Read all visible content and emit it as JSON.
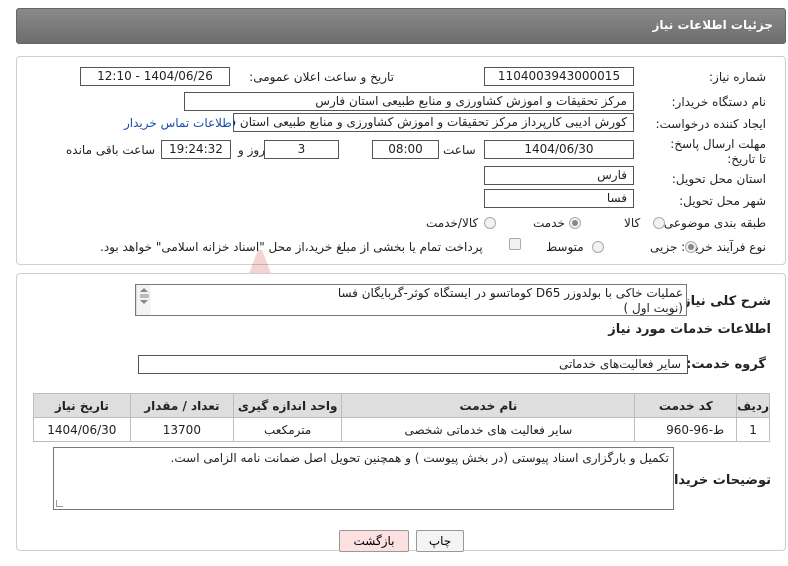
{
  "header": {
    "title": "جزئیات اطلاعات نیاز"
  },
  "fields": {
    "need_number_label": "شماره نیاز:",
    "need_number": "1104003943000015",
    "announce_label": "تاریخ و ساعت اعلان عمومی:",
    "announce_value": "1404/06/26 - 12:10",
    "buyer_label": "نام دستگاه خریدار:",
    "buyer_value": "مرکز تحقیقات و اموزش کشاورزی و منابع طبیعی استان فارس",
    "creator_label": "ایجاد کننده درخواست:",
    "creator_value": "کورش ادیبی کارپرداز مرکز تحقیقات و اموزش کشاورزی و منابع طبیعی استان فارس",
    "contact_link": "اطلاعات تماس خریدار",
    "deadline_label": "مهلت ارسال پاسخ: تا تاریخ:",
    "deadline_date": "1404/06/30",
    "time_label": "ساعت",
    "deadline_time": "08:00",
    "days_value": "3",
    "days_label": "روز و",
    "remaining_time": "19:24:32",
    "remaining_label": "ساعت باقی مانده",
    "province_label": "استان محل تحویل:",
    "province_value": "فارس",
    "city_label": "شهر محل تحویل:",
    "city_value": "فسا",
    "category_label": "طبقه بندی موضوعی:",
    "category_options": [
      "کالا",
      "خدمت",
      "کالا/خدمت"
    ],
    "process_label": "نوع فرآیند خرید :",
    "process_options": [
      "جزیی",
      "متوسط"
    ],
    "payment_note": "پرداخت تمام یا بخشی از مبلغ خرید،از محل \"اسناد خزانه اسلامی\" خواهد بود."
  },
  "summary": {
    "label": "شرح کلی نیاز:",
    "line1": "عملیات خاکی با بولدوزر D65 کوماتسو در ایستگاه کوثر-گربایگان فسا",
    "line2": "(نوبت اول )"
  },
  "services": {
    "section_title": "اطلاعات خدمات مورد نیاز",
    "group_label": "گروه خدمت:",
    "group_value": "سایر فعالیت‌های خدماتی",
    "columns": [
      "ردیف",
      "کد خدمت",
      "نام خدمت",
      "واحد اندازه گیری",
      "تعداد / مقدار",
      "تاریخ نیاز"
    ],
    "rows": [
      {
        "index": "1",
        "code": "ط-96-960",
        "name": "سایر فعالیت های خدماتی شخصی",
        "unit": "مترمکعب",
        "qty": "13700",
        "date": "1404/06/30"
      }
    ]
  },
  "notes": {
    "label": "توضیحات خریدار:",
    "text": "تکمیل و بارگزاری اسناد پیوستی (در بخش پیوست ) و همچنین تحویل اصل ضمانت نامه الزامی است."
  },
  "buttons": {
    "print": "چاپ",
    "back": "بازگشت"
  },
  "colors": {
    "back_button_bg": "#fde0e0",
    "print_button_bg": "#f4f4f4",
    "header_bg": "#7a7a7a",
    "link": "#1a4fa8"
  }
}
